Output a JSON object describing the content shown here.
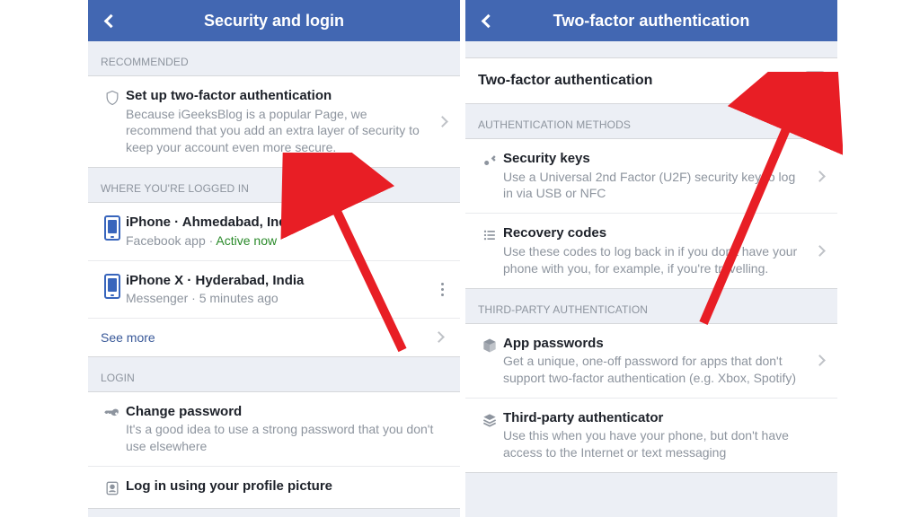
{
  "left_screen": {
    "nav_title": "Security and login",
    "sections": {
      "recommended": {
        "header": "RECOMMENDED",
        "item": {
          "title": "Set up two-factor authentication",
          "subtitle": "Because iGeeksBlog is a popular Page, we recommend that you add an extra layer of security to keep your account even more secure."
        }
      },
      "logged_in": {
        "header": "WHERE YOU'RE LOGGED IN",
        "devices": [
          {
            "name": "iPhone · Ahmedabad, India",
            "app": "Facebook app",
            "status": "Active now"
          },
          {
            "name": "iPhone X · Hyderabad, India",
            "app": "Messenger",
            "status": "5 minutes ago"
          }
        ],
        "see_more": "See more"
      },
      "login": {
        "header": "LOGIN",
        "items": [
          {
            "title": "Change password",
            "subtitle": "It's a good idea to use a strong password that you don't use elsewhere"
          },
          {
            "title": "Log in using your profile picture"
          }
        ]
      }
    }
  },
  "right_screen": {
    "nav_title": "Two-factor authentication",
    "toggle": {
      "label": "Two-factor authentication",
      "checked": true
    },
    "sections": {
      "auth_methods": {
        "header": "AUTHENTICATION METHODS",
        "items": [
          {
            "title": "Security keys",
            "subtitle": "Use a Universal 2nd Factor (U2F) security key to log in via USB or NFC"
          },
          {
            "title": "Recovery codes",
            "subtitle": "Use these codes to log back in if you don't have your phone with you, for example, if you're travelling."
          }
        ]
      },
      "third_party": {
        "header": "THIRD-PARTY AUTHENTICATION",
        "items": [
          {
            "title": "App passwords",
            "subtitle": "Get a unique, one-off password for apps that don't support two-factor authentication (e.g. Xbox, Spotify)"
          },
          {
            "title": "Third-party authenticator",
            "subtitle": "Use this when you have your phone, but don't have access to the Internet or text messaging"
          }
        ]
      }
    }
  },
  "colors": {
    "brand": "#4267b2",
    "arrow": "#e81e25",
    "check": "#3578e5"
  }
}
